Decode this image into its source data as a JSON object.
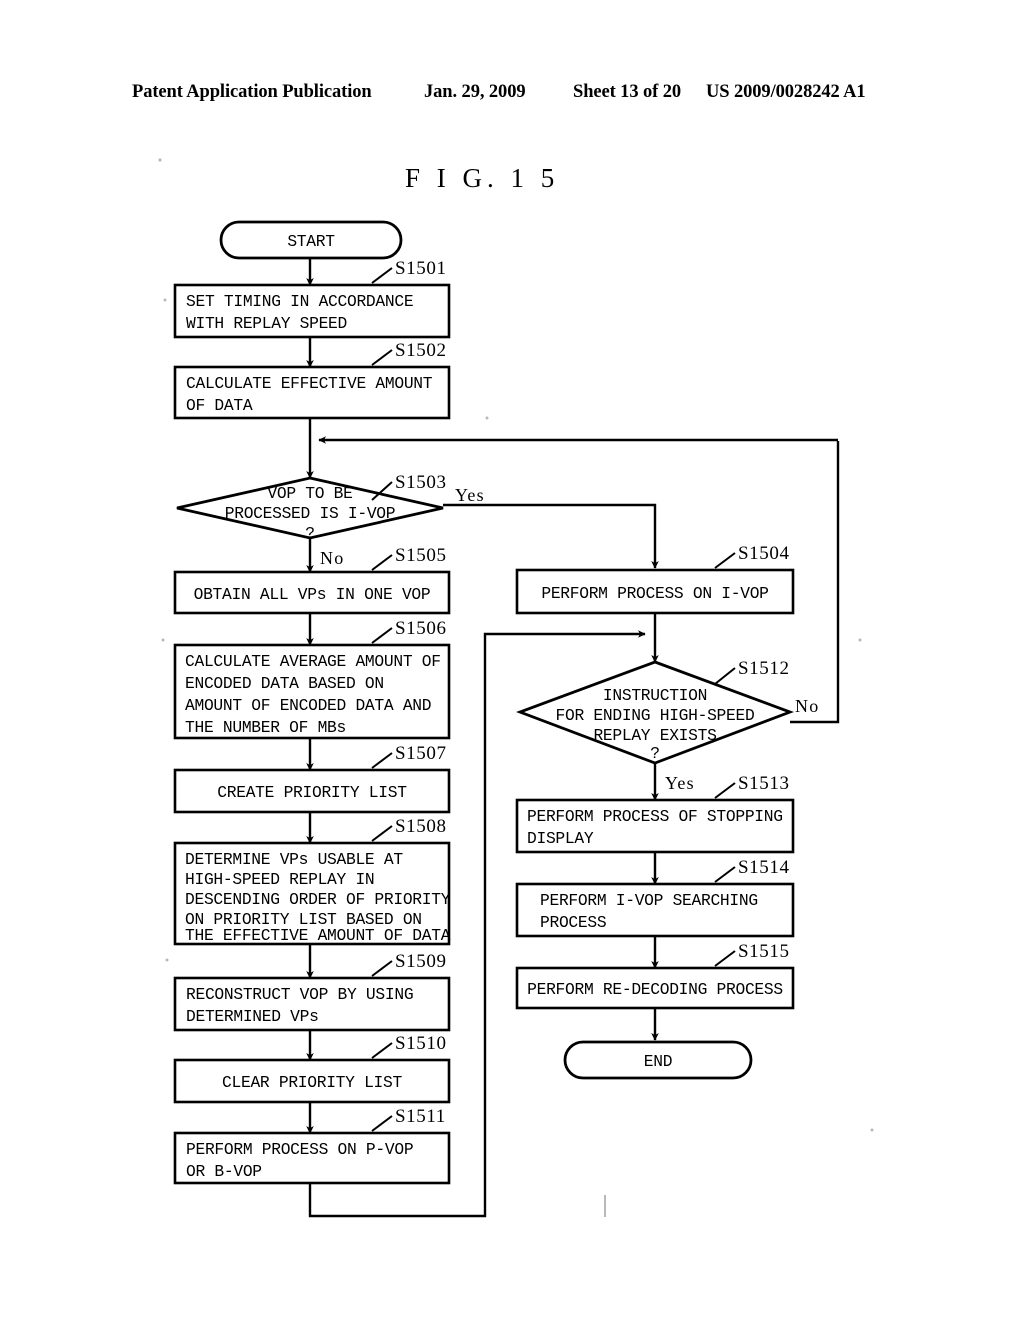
{
  "header": {
    "publication": "Patent Application Publication",
    "date": "Jan. 29, 2009",
    "sheet": "Sheet 13 of 20",
    "number": "US 2009/0028242 A1"
  },
  "figure": {
    "title": "F I G.  1 5"
  },
  "flowchart": {
    "terminals": {
      "start": "START",
      "end": "END"
    },
    "branch_labels": {
      "yes_s1503": "Yes",
      "no_s1503": "No",
      "no_s1512": "No",
      "yes_s1512": "Yes"
    },
    "nodes": [
      {
        "id": "start",
        "type": "terminal",
        "label": "START",
        "step": ""
      },
      {
        "id": "s1501",
        "type": "process",
        "step": "S1501",
        "lines": [
          "SET TIMING IN ACCORDANCE",
          "WITH REPLAY SPEED"
        ]
      },
      {
        "id": "s1502",
        "type": "process",
        "step": "S1502",
        "lines": [
          "CALCULATE EFFECTIVE AMOUNT",
          "OF DATA"
        ]
      },
      {
        "id": "s1503",
        "type": "decision",
        "step": "S1503",
        "lines": [
          "VOP TO BE",
          "PROCESSED IS I-VOP",
          "?"
        ]
      },
      {
        "id": "s1504",
        "type": "process",
        "step": "S1504",
        "lines": [
          "PERFORM PROCESS ON I-VOP"
        ]
      },
      {
        "id": "s1505",
        "type": "process",
        "step": "S1505",
        "lines": [
          "OBTAIN ALL VPs IN ONE VOP"
        ]
      },
      {
        "id": "s1506",
        "type": "process",
        "step": "S1506",
        "lines": [
          "CALCULATE AVERAGE AMOUNT OF",
          "ENCODED DATA BASED ON",
          "AMOUNT OF ENCODED DATA AND",
          "THE NUMBER OF MBs"
        ]
      },
      {
        "id": "s1507",
        "type": "process",
        "step": "S1507",
        "lines": [
          "CREATE PRIORITY LIST"
        ]
      },
      {
        "id": "s1508",
        "type": "process",
        "step": "S1508",
        "lines": [
          "DETERMINE VPs USABLE AT",
          "HIGH-SPEED REPLAY IN",
          "DESCENDING ORDER OF PRIORITY",
          "ON PRIORITY LIST BASED ON",
          "THE EFFECTIVE AMOUNT OF DATA"
        ]
      },
      {
        "id": "s1509",
        "type": "process",
        "step": "S1509",
        "lines": [
          "RECONSTRUCT VOP BY USING",
          "DETERMINED VPs"
        ]
      },
      {
        "id": "s1510",
        "type": "process",
        "step": "S1510",
        "lines": [
          "CLEAR PRIORITY LIST"
        ]
      },
      {
        "id": "s1511",
        "type": "process",
        "step": "S1511",
        "lines": [
          "PERFORM PROCESS ON P-VOP",
          "OR B-VOP"
        ]
      },
      {
        "id": "s1512",
        "type": "decision",
        "step": "S1512",
        "lines": [
          "INSTRUCTION",
          "FOR ENDING HIGH-SPEED",
          "REPLAY EXISTS",
          "?"
        ]
      },
      {
        "id": "s1513",
        "type": "process",
        "step": "S1513",
        "lines": [
          "PERFORM PROCESS OF STOPPING",
          "DISPLAY"
        ]
      },
      {
        "id": "s1514",
        "type": "process",
        "step": "S1514",
        "lines": [
          "PERFORM I-VOP SEARCHING",
          "PROCESS"
        ]
      },
      {
        "id": "s1515",
        "type": "process",
        "step": "S1515",
        "lines": [
          "PERFORM RE-DECODING PROCESS"
        ]
      },
      {
        "id": "end",
        "type": "terminal",
        "label": "END",
        "step": ""
      }
    ]
  },
  "colors": {
    "ink": "#000000",
    "paper": "#ffffff"
  }
}
